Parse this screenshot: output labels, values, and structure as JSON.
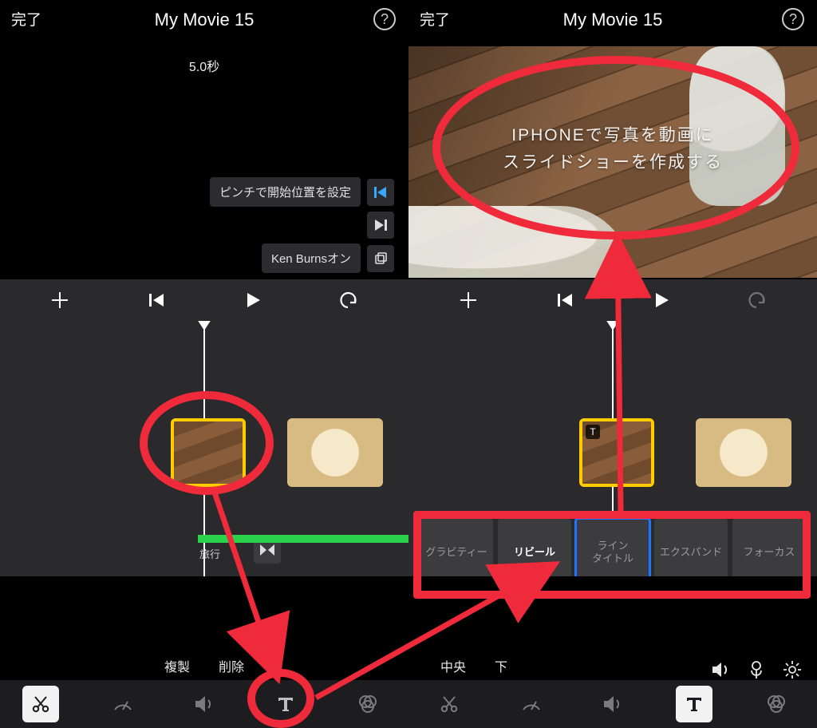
{
  "left": {
    "done": "完了",
    "title": "My Movie 15",
    "seconds": "5.0秒",
    "pinch_hint": "ピンチで開始位置を設定",
    "kenburns": "Ken Burnsオン",
    "track_label": "旅行",
    "actions": {
      "duplicate": "複製",
      "delete": "削除"
    }
  },
  "right": {
    "done": "完了",
    "title": "My Movie 15",
    "overlay_line1": "IPHONEで写真を動画に",
    "overlay_line2": "スライドショーを作成する",
    "title_styles": {
      "gravity": "グラビティー",
      "reveal": "リビール",
      "line_title": "ライン\nタイトル",
      "expand": "エクスパンド",
      "focus": "フォーカス"
    },
    "positions": {
      "center": "中央",
      "bottom": "下"
    }
  }
}
